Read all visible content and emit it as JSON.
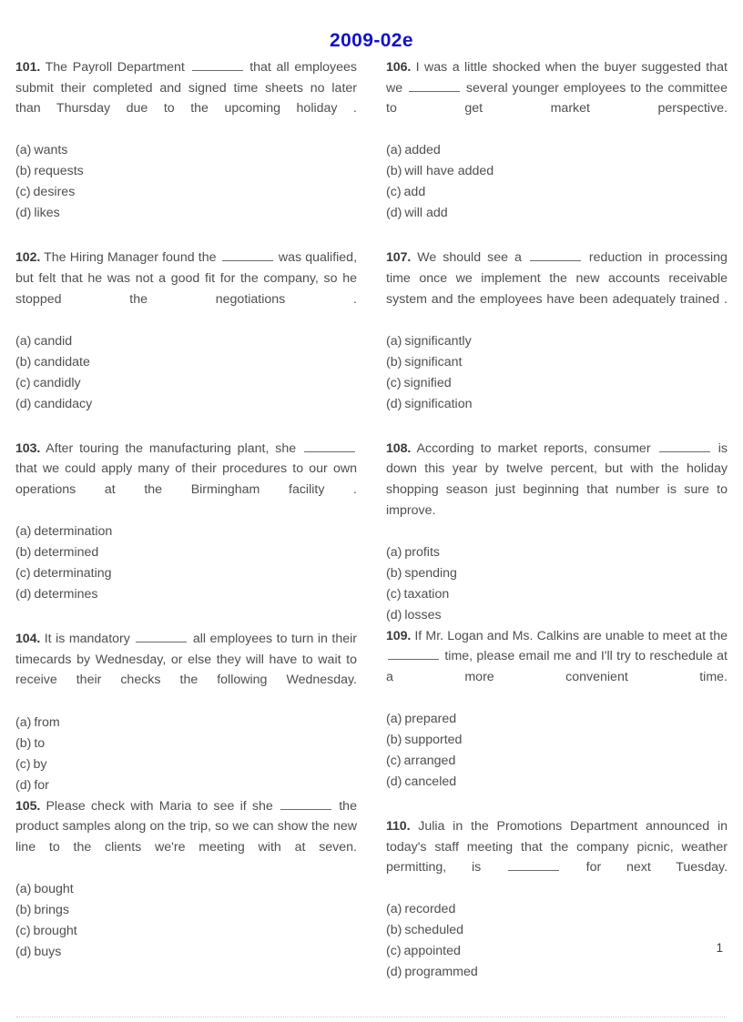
{
  "document": {
    "title": "2009-02e",
    "title_color": "#1111cc",
    "page_number": "1"
  },
  "columns": {
    "left": [
      {
        "number": "101.",
        "stem_before": "The Payroll Department",
        "stem_after": "that all employees submit their completed and signed time sheets no later than Thursday due to the upcoming holiday .",
        "choices": [
          {
            "key": "(a)",
            "text": "wants"
          },
          {
            "key": "(b)",
            "text": "requests"
          },
          {
            "key": "(c)",
            "text": "desires"
          },
          {
            "key": "(d)",
            "text": "likes"
          }
        ]
      },
      {
        "number": "102.",
        "stem_before": "The Hiring Manager found the",
        "stem_after": "was qualified, but felt that he was not a good fit for the company, so he stopped the negotiations .",
        "choices": [
          {
            "key": "(a)",
            "text": "candid"
          },
          {
            "key": "(b)",
            "text": "candidate"
          },
          {
            "key": "(c)",
            "text": "candidly"
          },
          {
            "key": "(d)",
            "text": "candidacy"
          }
        ]
      },
      {
        "number": "103.",
        "stem_before": "After touring the manufacturing plant, she",
        "stem_after": "that we could apply many of their procedures to our own operations at the Birmingham facility .",
        "choices": [
          {
            "key": "(a)",
            "text": "determination"
          },
          {
            "key": "(b)",
            "text": "determined"
          },
          {
            "key": "(c)",
            "text": "determinating"
          },
          {
            "key": "(d)",
            "text": "determines"
          }
        ]
      },
      {
        "number": "104.",
        "stem_before": "It is mandatory",
        "stem_after": "all employees to turn in their timecards by Wednesday, or else they will have to wait to receive their checks the following Wednesday.",
        "choices": [
          {
            "key": "(a)",
            "text": "from"
          },
          {
            "key": "(b)",
            "text": "to"
          },
          {
            "key": "(c)",
            "text": "by"
          },
          {
            "key": "(d)",
            "text": "for"
          }
        ]
      },
      {
        "number": "105.",
        "stem_before": "Please check with Maria to see if she",
        "stem_after": "the product samples along on the trip, so we can show the new line to the clients we're meeting with at seven.",
        "choices": [
          {
            "key": "(a)",
            "text": "bought"
          },
          {
            "key": "(b)",
            "text": "brings"
          },
          {
            "key": "(c)",
            "text": "brought"
          },
          {
            "key": "(d)",
            "text": "buys"
          }
        ]
      }
    ],
    "right": [
      {
        "number": "106.",
        "stem_before": "I was a little shocked when the buyer suggested that we",
        "stem_after": "several younger employees to the committee to get market perspective.",
        "choices": [
          {
            "key": "(a)",
            "text": "added"
          },
          {
            "key": "(b)",
            "text": "will have added"
          },
          {
            "key": "(c)",
            "text": "add"
          },
          {
            "key": "(d)",
            "text": "will add"
          }
        ]
      },
      {
        "number": "107.",
        "stem_before": "We should see a",
        "stem_after": "reduction in processing time once we implement the new accounts receivable system and the employees have been adequately trained .",
        "choices": [
          {
            "key": "(a)",
            "text": "significantly"
          },
          {
            "key": "(b)",
            "text": "significant"
          },
          {
            "key": "(c)",
            "text": "signified"
          },
          {
            "key": "(d)",
            "text": "signification"
          }
        ]
      },
      {
        "number": "108.",
        "stem_before": "According to market reports, consumer",
        "stem_after": "is down this year by twelve percent, but with the holiday shopping season just beginning that number is sure to improve.",
        "choices": [
          {
            "key": "(a)",
            "text": "profits"
          },
          {
            "key": "(b)",
            "text": "spending"
          },
          {
            "key": "(c)",
            "text": "taxation"
          },
          {
            "key": "(d)",
            "text": "losses"
          }
        ]
      },
      {
        "number": "109.",
        "stem_before": "If Mr. Logan and Ms. Calkins are unable to meet at the",
        "stem_after": "time, please email me and I'll try to reschedule at a more convenient time.",
        "choices": [
          {
            "key": "(a)",
            "text": "prepared"
          },
          {
            "key": "(b)",
            "text": "supported"
          },
          {
            "key": "(c)",
            "text": "arranged"
          },
          {
            "key": "(d)",
            "text": "canceled"
          }
        ]
      },
      {
        "number": "110.",
        "stem_before": "Julia in the Promotions Department announced in today's staff meeting that the company picnic, weather permitting, is",
        "stem_after": "for next Tuesday.",
        "choices": [
          {
            "key": "(a)",
            "text": "recorded"
          },
          {
            "key": "(b)",
            "text": "scheduled"
          },
          {
            "key": "(c)",
            "text": "appointed"
          },
          {
            "key": "(d)",
            "text": "programmed"
          }
        ]
      }
    ]
  }
}
